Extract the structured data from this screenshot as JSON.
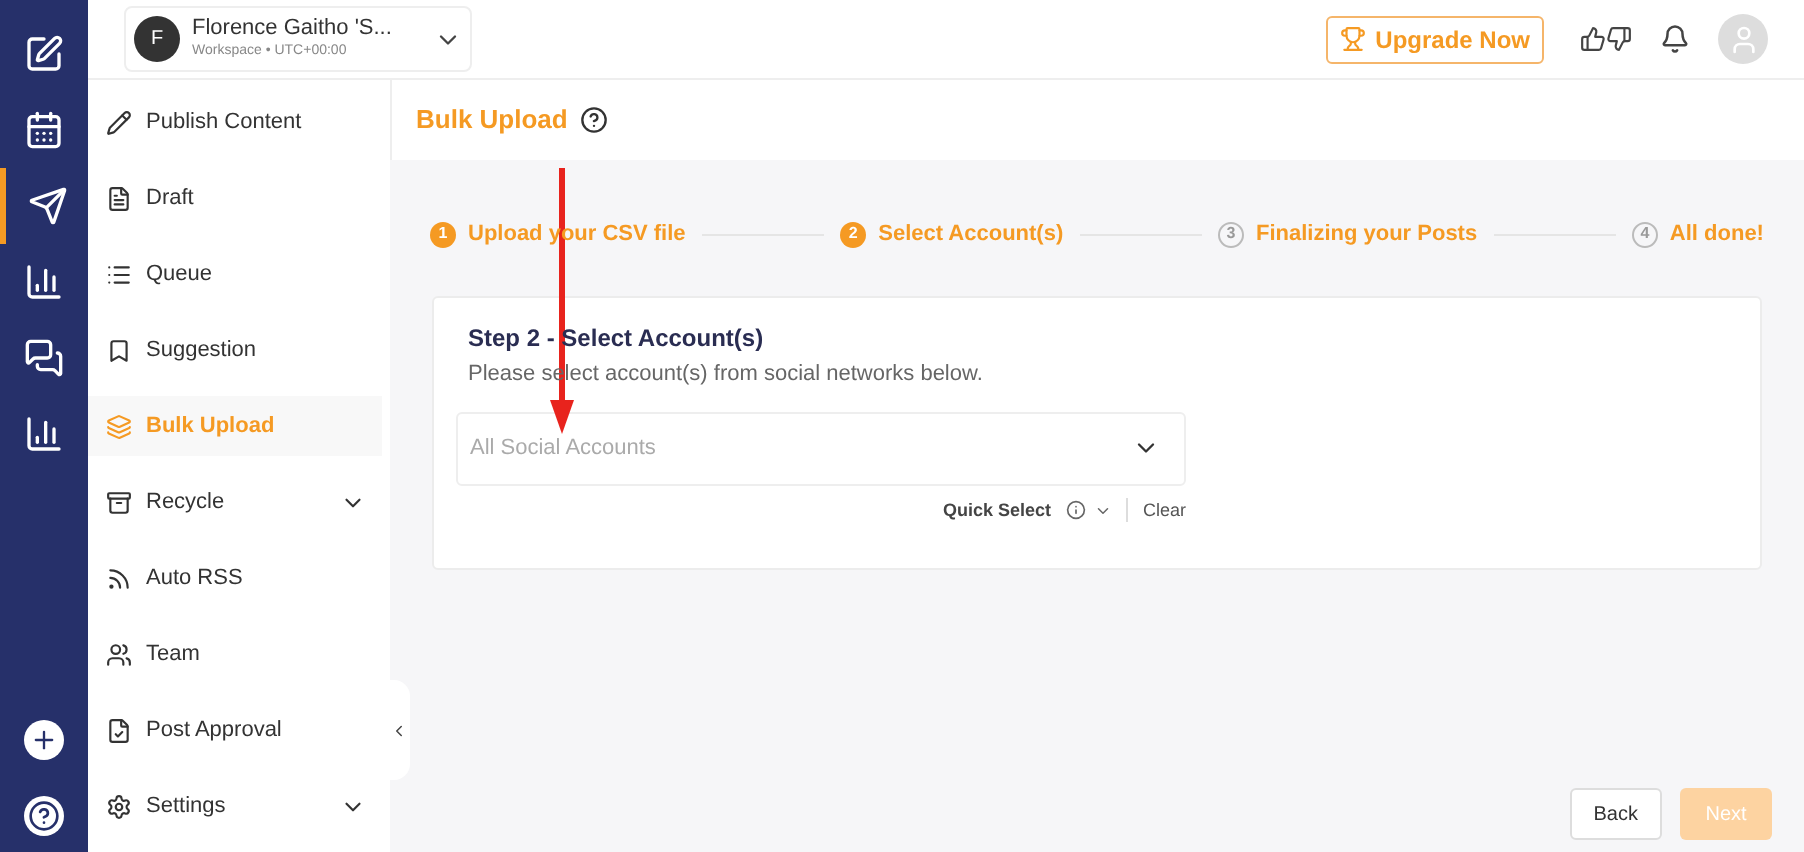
{
  "rail": {
    "items": [
      {
        "selected": false
      },
      {
        "selected": false
      },
      {
        "selected": true
      },
      {
        "selected": false
      },
      {
        "selected": false
      },
      {
        "selected": false
      }
    ]
  },
  "workspace": {
    "initial": "F",
    "name": "Florence Gaitho 'S...",
    "subtitle": "Workspace • UTC+00:00"
  },
  "topbar": {
    "upgrade": "Upgrade Now"
  },
  "sidebar": {
    "items": [
      {
        "label": "Publish Content",
        "selected": false,
        "expandable": false
      },
      {
        "label": "Draft",
        "selected": false,
        "expandable": false
      },
      {
        "label": "Queue",
        "selected": false,
        "expandable": false
      },
      {
        "label": "Suggestion",
        "selected": false,
        "expandable": false
      },
      {
        "label": "Bulk Upload",
        "selected": true,
        "expandable": false
      },
      {
        "label": "Recycle",
        "selected": false,
        "expandable": true
      },
      {
        "label": "Auto RSS",
        "selected": false,
        "expandable": false
      },
      {
        "label": "Team",
        "selected": false,
        "expandable": false
      },
      {
        "label": "Post Approval",
        "selected": false,
        "expandable": false
      },
      {
        "label": "Settings",
        "selected": false,
        "expandable": true
      }
    ]
  },
  "page": {
    "title": "Bulk Upload"
  },
  "steps": [
    {
      "number": "1",
      "label": "Upload your CSV file",
      "reached": true
    },
    {
      "number": "2",
      "label": "Select Account(s)",
      "reached": true
    },
    {
      "number": "3",
      "label": "Finalizing your Posts",
      "reached": false
    },
    {
      "number": "4",
      "label": "All done!",
      "reached": false
    }
  ],
  "card": {
    "title": "Step 2 - Select Account(s)",
    "subtitle": "Please select account(s) from social networks below.",
    "select_placeholder": "All Social Accounts",
    "quick_select": "Quick Select",
    "clear": "Clear"
  },
  "footer": {
    "back": "Back",
    "next": {
      "label": "Next",
      "disabled": true
    }
  }
}
